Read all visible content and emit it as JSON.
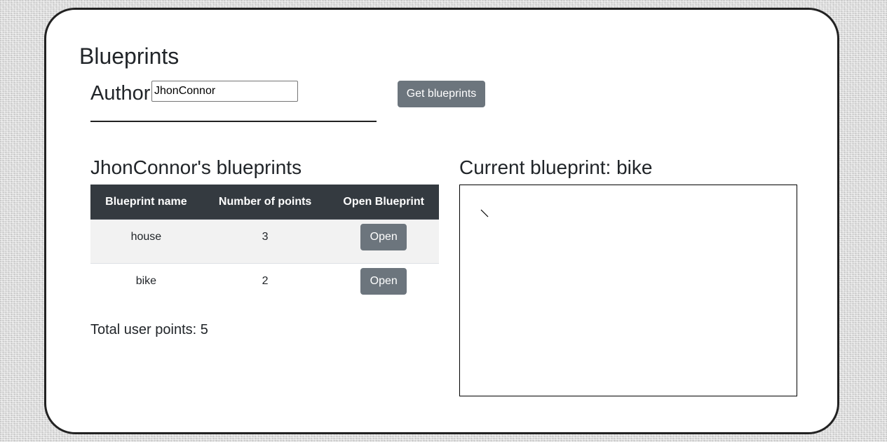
{
  "header": {
    "title": "Blueprints",
    "author_label": "Author",
    "author_value": "JhonConnor",
    "get_button": "Get blueprints"
  },
  "list": {
    "title": "JhonConnor's blueprints",
    "columns": [
      "Blueprint name",
      "Number of points",
      "Open Blueprint"
    ],
    "rows": [
      {
        "name": "house",
        "points": "3",
        "action": "Open"
      },
      {
        "name": "bike",
        "points": "2",
        "action": "Open"
      }
    ],
    "total": "Total user points: 5"
  },
  "current": {
    "title": "Current blueprint: bike"
  },
  "colors": {
    "header_bg": "#343a40",
    "button_bg": "#6c757d"
  }
}
